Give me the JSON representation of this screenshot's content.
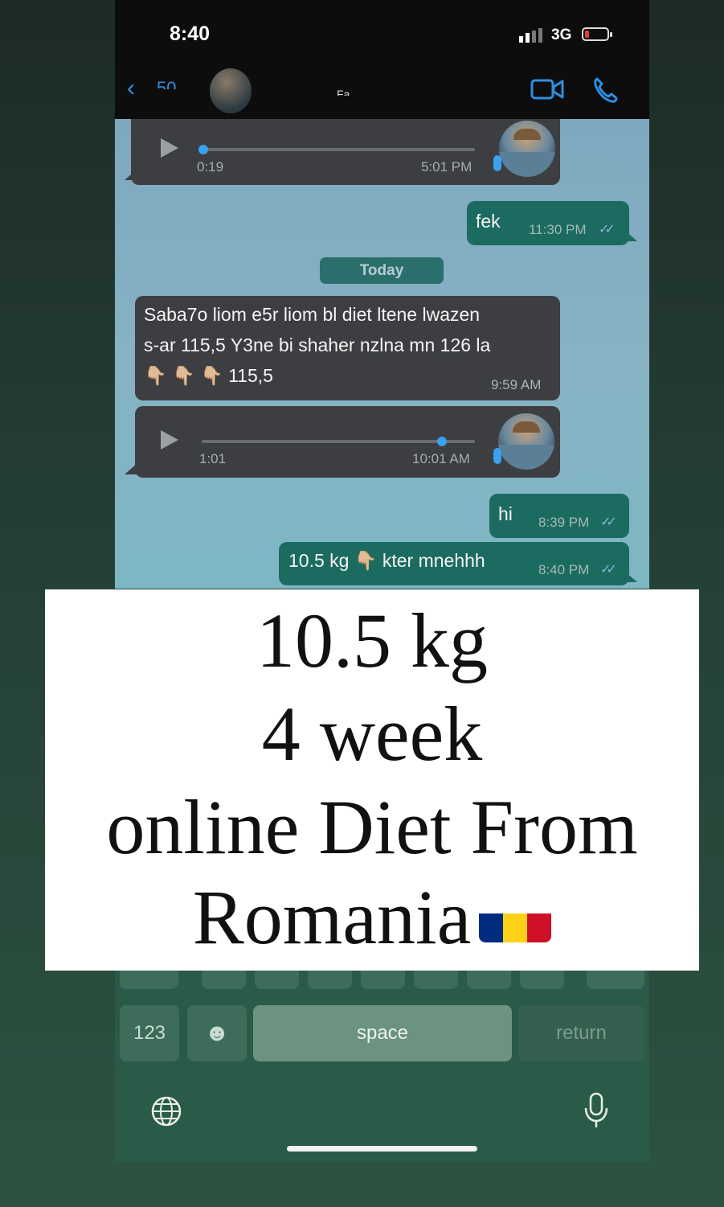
{
  "status_bar": {
    "time": "8:40",
    "network": "3G"
  },
  "nav": {
    "back_icon": "chevron-left-icon",
    "back_count": "50",
    "contact_name": "Fa..."
  },
  "chat": {
    "messages": [
      {
        "type": "voice",
        "direction": "in",
        "duration": "0:19",
        "time": "5:01 PM",
        "progress": 0
      },
      {
        "type": "text",
        "direction": "out",
        "text": "fek",
        "time": "11:30 PM",
        "read": true
      },
      {
        "type": "date",
        "label": "Today"
      },
      {
        "type": "text",
        "direction": "in",
        "lines": [
          "Saba7o liom e5r liom bl diet ltene lwazen",
          "s-ar 115,5 Y3ne bi shaher nzlna mn 126 la",
          "👇🏼 👇🏼 👇🏼 115,5"
        ],
        "time": "9:59 AM"
      },
      {
        "type": "voice",
        "direction": "in",
        "duration": "1:01",
        "time": "10:01 AM",
        "progress": 0.88
      },
      {
        "type": "text",
        "direction": "out",
        "text": "hi",
        "time": "8:39 PM",
        "read": true
      },
      {
        "type": "text",
        "direction": "out",
        "text": "10.5 kg 👇🏼 kter mnehhh",
        "time": "8:40 PM",
        "read": true
      }
    ]
  },
  "keyboard": {
    "numbers_key": "123",
    "space_key": "space",
    "return_key": "return",
    "emoji_key": "☻"
  },
  "overlay": {
    "line1": "10.5 kg",
    "line2": "4 week",
    "line3": "online Diet From",
    "line4": "Romania",
    "flag_colors": [
      "#002B7F",
      "#FCD116",
      "#CE1126"
    ]
  }
}
